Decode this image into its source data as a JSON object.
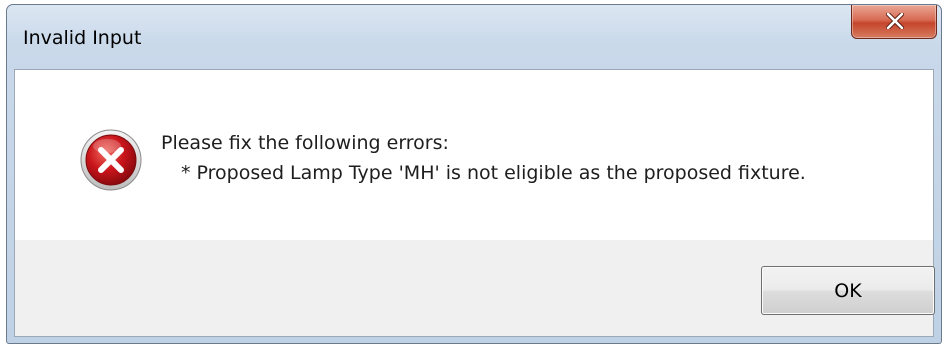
{
  "window": {
    "title": "Invalid Input"
  },
  "dialog": {
    "heading": "Please fix the following errors:",
    "errors": [
      "* Proposed Lamp Type 'MH' is not eligible as the proposed fixture."
    ],
    "icon": "error-icon",
    "ok_label": "OK"
  },
  "colors": {
    "close_button": "#c5452c",
    "error_icon": "#c0161a",
    "title_bar": "#c9d9ea"
  }
}
